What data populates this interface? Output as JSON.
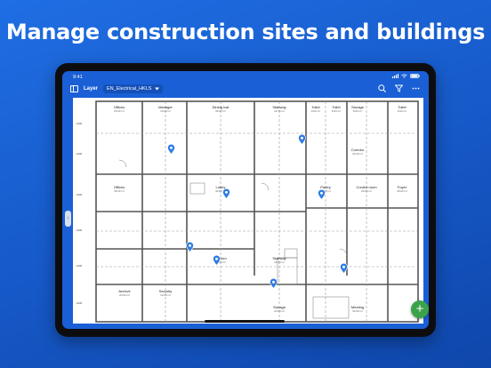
{
  "headline": "Manage construction sites and buildings",
  "status": {
    "time": "9:41"
  },
  "toolbar": {
    "layer_label": "Layer",
    "layer_value": "EN_Electrical_HKLS",
    "icons": [
      "sidebar-icon",
      "search-icon",
      "filter-icon",
      "more-icon"
    ]
  },
  "plan": {
    "rooms": [
      {
        "name": "Offices",
        "area": "25.00 m²"
      },
      {
        "name": "Manager",
        "area": "16.00 m²"
      },
      {
        "name": "Dining hall",
        "area": "35.00 m²"
      },
      {
        "name": "Stairway",
        "area": "16.70 m²"
      },
      {
        "name": "Toilet",
        "area": "8.00 m²"
      },
      {
        "name": "Toilet",
        "area": "8.00 m²"
      },
      {
        "name": "Storage",
        "area": "8.00 m²"
      },
      {
        "name": "Toilet",
        "area": "8.00 m²"
      },
      {
        "name": "Corridor",
        "area": "40.00 m²"
      },
      {
        "name": "Offices",
        "area": "45.00 m²"
      },
      {
        "name": "Lobby",
        "area": "30.00 m²"
      },
      {
        "name": "Pantry",
        "area": "10.00 m²"
      },
      {
        "name": "Control room",
        "area": "20.00 m²"
      },
      {
        "name": "Foyer",
        "area": "18.00 m²"
      },
      {
        "name": "Kitchen",
        "area": "22.00 m²"
      },
      {
        "name": "Stairway",
        "area": "16.70 m²"
      },
      {
        "name": "Archive",
        "area": "20.00 m²"
      },
      {
        "name": "Security",
        "area": "12.00 m²"
      },
      {
        "name": "Storage",
        "area": "20.00 m²"
      },
      {
        "name": "Meeting",
        "area": "30.00 m²"
      }
    ]
  },
  "colors": {
    "accent": "#1a5fd6",
    "pin": "#2f7de1",
    "fab": "#3aa34a"
  },
  "fab_label": "+"
}
